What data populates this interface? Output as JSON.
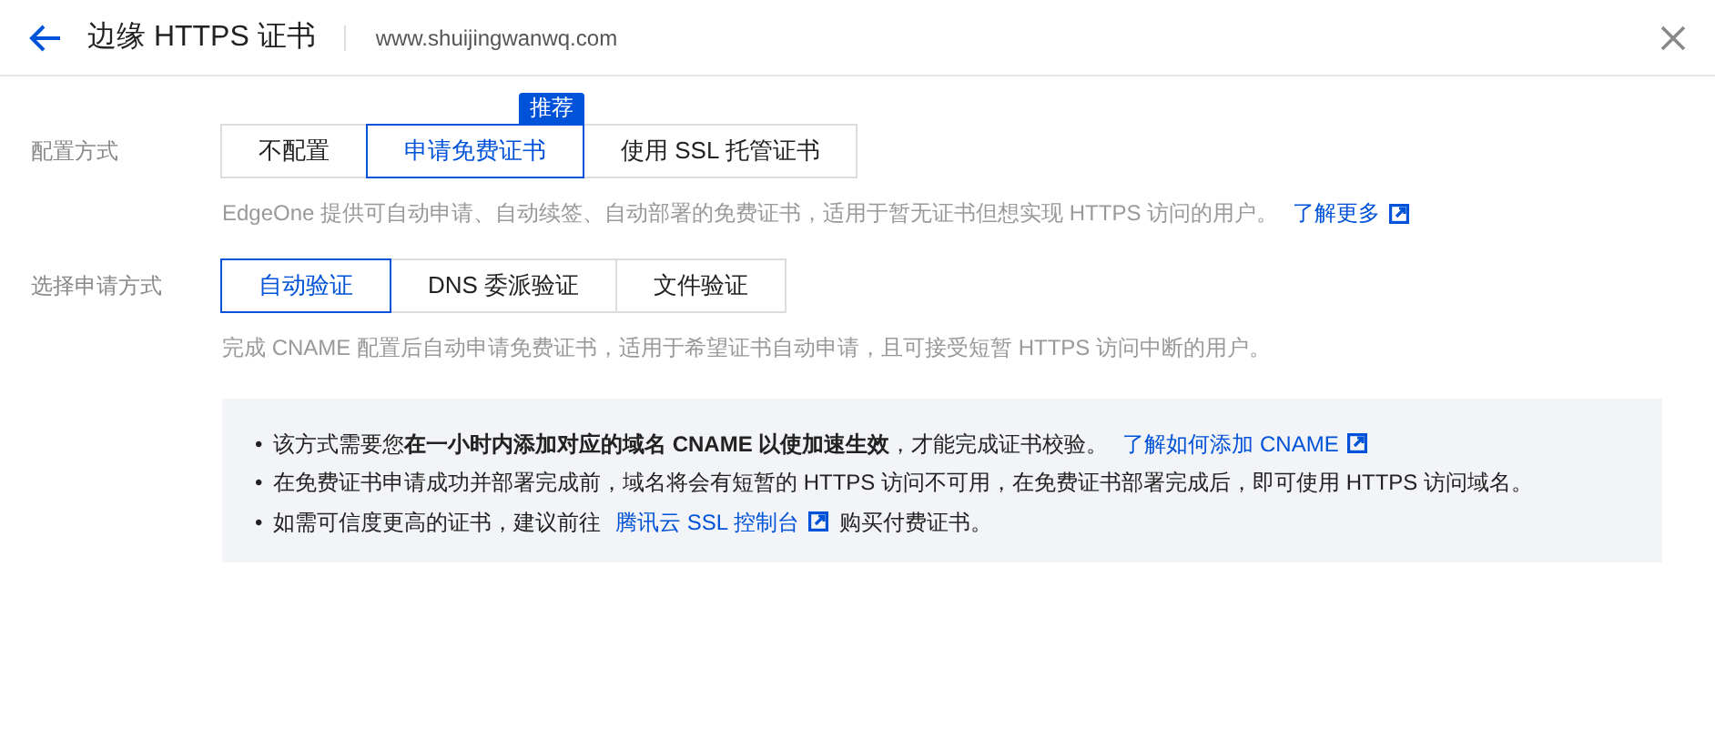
{
  "header": {
    "title": "边缘 HTTPS 证书",
    "domain": "www.shuijingwanwq.com"
  },
  "fields": [
    {
      "label": "配置方式",
      "options": [
        {
          "label": "不配置",
          "selected": false
        },
        {
          "label": "申请免费证书",
          "selected": true,
          "badge": "推荐"
        },
        {
          "label": "使用 SSL 托管证书",
          "selected": false
        }
      ],
      "description": "EdgeOne 提供可自动申请、自动续签、自动部署的免费证书，适用于暂无证书但想实现 HTTPS 访问的用户。",
      "link": "了解更多"
    },
    {
      "label": "选择申请方式",
      "options": [
        {
          "label": "自动验证",
          "selected": true
        },
        {
          "label": "DNS 委派验证",
          "selected": false
        },
        {
          "label": "文件验证",
          "selected": false
        }
      ],
      "description": "完成 CNAME 配置后自动申请免费证书，适用于希望证书自动申请，且可接受短暂 HTTPS 访问中断的用户。"
    }
  ],
  "notes": [
    {
      "bullet": "•",
      "text": "该方式需要您**在一小时内添加对应的域名 CNAME 以使加速生效**，才能完成证书校验。",
      "link": "了解如何添加 CNAME"
    },
    {
      "bullet": "•",
      "text": "在免费证书申请成功并部署完成前，域名将会有短暂的 HTTPS 访问不可用，在免费证书部署完成后，即可使用 HTTPS 访问域名。"
    },
    {
      "bullet": "•",
      "text": "如需可信度更高的证书，建议前往",
      "link": "腾讯云 SSL 控制台",
      "suffix": "购买付费证书。"
    }
  ]
}
